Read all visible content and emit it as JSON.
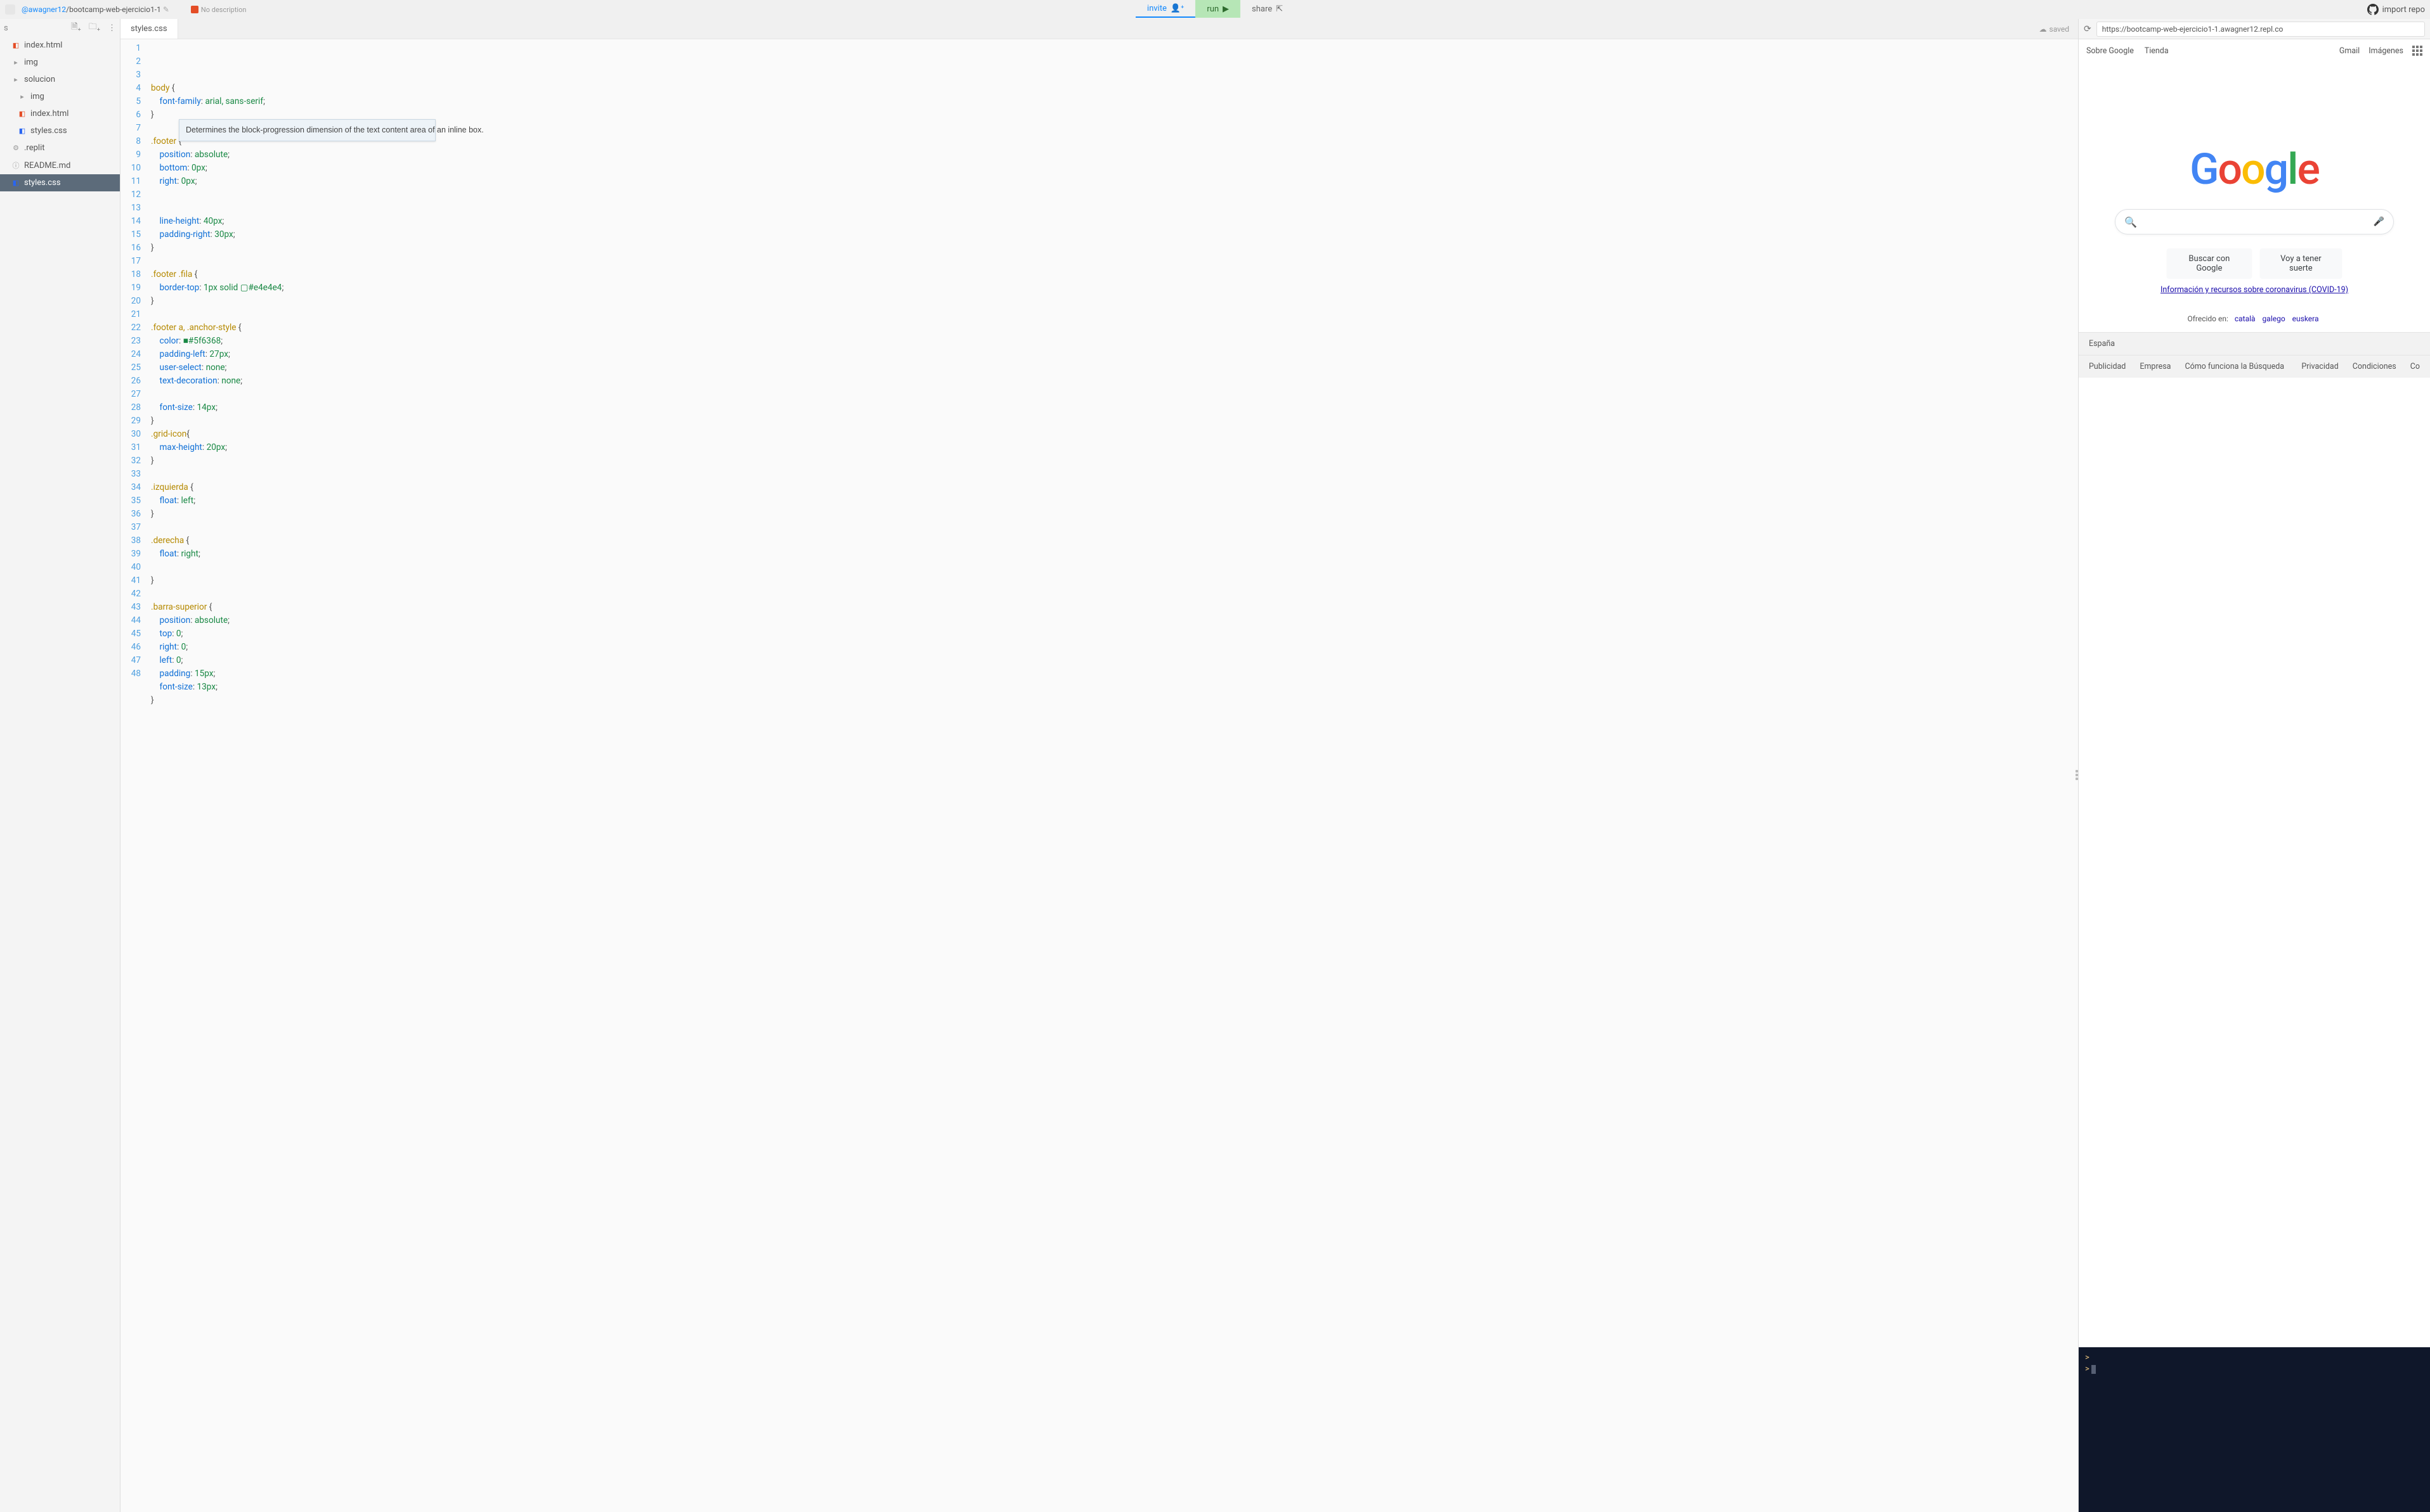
{
  "header": {
    "user": "@awagner12",
    "project": "bootcamp-web-ejercicio1-1",
    "no_description": "No description",
    "invite": "invite",
    "run": "run",
    "share": "share",
    "import_repo": "import repo"
  },
  "sidebar": {
    "head_label": "s",
    "items": [
      {
        "label": "index.html",
        "icon": "html"
      },
      {
        "label": "img",
        "icon": "folder"
      },
      {
        "label": "solucion",
        "icon": "folder"
      },
      {
        "label": "img",
        "icon": "folder",
        "child": true
      },
      {
        "label": "index.html",
        "icon": "html",
        "child": true
      },
      {
        "label": "styles.css",
        "icon": "css",
        "child": true
      },
      {
        "label": ".replit",
        "icon": "gear"
      },
      {
        "label": "README.md",
        "icon": "md"
      },
      {
        "label": "styles.css",
        "icon": "css",
        "active": true
      }
    ]
  },
  "editor": {
    "tab": "styles.css",
    "saved": "saved",
    "tooltip": "Determines the block-progression dimension of the text content area of an inline box.",
    "lines": [
      {
        "n": 1,
        "t": "body {",
        "cls": "sel"
      },
      {
        "n": 2,
        "t": "    font-family: arial, sans-serif;",
        "p": "font-family",
        "v": "arial, sans-serif"
      },
      {
        "n": 3,
        "t": "}",
        "cls": "punc"
      },
      {
        "n": 4,
        "t": ""
      },
      {
        "n": 5,
        "t": ".footer {",
        "cls": "sel"
      },
      {
        "n": 6,
        "t": "    position: absolute;",
        "p": "position",
        "v": "absolute"
      },
      {
        "n": 7,
        "t": "    bottom: 0px;",
        "p": "bottom",
        "v": "0px"
      },
      {
        "n": 8,
        "t": "    right: 0px;",
        "p": "right",
        "v": "0px"
      },
      {
        "n": 9,
        "t": ""
      },
      {
        "n": 10,
        "t": ""
      },
      {
        "n": 11,
        "t": "    line-height: 40px;",
        "p": "line-height",
        "v": "40px"
      },
      {
        "n": 12,
        "t": "    padding-right: 30px;",
        "p": "padding-right",
        "v": "30px"
      },
      {
        "n": 13,
        "t": "}",
        "cls": "punc"
      },
      {
        "n": 14,
        "t": ""
      },
      {
        "n": 15,
        "t": ".footer .fila {",
        "cls": "sel"
      },
      {
        "n": 16,
        "t": "    border-top: 1px solid ▢#e4e4e4;",
        "p": "border-top",
        "v": "1px solid ▢#e4e4e4"
      },
      {
        "n": 17,
        "t": "}",
        "cls": "punc"
      },
      {
        "n": 18,
        "t": ""
      },
      {
        "n": 19,
        "t": ".footer a, .anchor-style {",
        "cls": "sel"
      },
      {
        "n": 20,
        "t": "    color: ■#5f6368;",
        "p": "color",
        "v": "■#5f6368"
      },
      {
        "n": 21,
        "t": "    padding-left: 27px;",
        "p": "padding-left",
        "v": "27px"
      },
      {
        "n": 22,
        "t": "    user-select: none;",
        "p": "user-select",
        "v": "none"
      },
      {
        "n": 23,
        "t": "    text-decoration: none;",
        "p": "text-decoration",
        "v": "none"
      },
      {
        "n": 24,
        "t": ""
      },
      {
        "n": 25,
        "t": "    font-size: 14px;",
        "p": "font-size",
        "v": "14px"
      },
      {
        "n": 26,
        "t": "}",
        "cls": "punc"
      },
      {
        "n": 27,
        "t": ".grid-icon{",
        "cls": "sel"
      },
      {
        "n": 28,
        "t": "    max-height: 20px;",
        "p": "max-height",
        "v": "20px"
      },
      {
        "n": 29,
        "t": "}",
        "cls": "punc"
      },
      {
        "n": 30,
        "t": ""
      },
      {
        "n": 31,
        "t": ".izquierda {",
        "cls": "sel"
      },
      {
        "n": 32,
        "t": "    float: left;",
        "p": "float",
        "v": "left"
      },
      {
        "n": 33,
        "t": "}",
        "cls": "punc"
      },
      {
        "n": 34,
        "t": ""
      },
      {
        "n": 35,
        "t": ".derecha {",
        "cls": "sel"
      },
      {
        "n": 36,
        "t": "    float: right;",
        "p": "float",
        "v": "right"
      },
      {
        "n": 37,
        "t": ""
      },
      {
        "n": 38,
        "t": "}",
        "cls": "punc"
      },
      {
        "n": 39,
        "t": ""
      },
      {
        "n": 40,
        "t": ".barra-superior {",
        "cls": "sel"
      },
      {
        "n": 41,
        "t": "    position: absolute;",
        "p": "position",
        "v": "absolute"
      },
      {
        "n": 42,
        "t": "    top: 0;",
        "p": "top",
        "v": "0"
      },
      {
        "n": 43,
        "t": "    right: 0;",
        "p": "right",
        "v": "0"
      },
      {
        "n": 44,
        "t": "    left: 0;",
        "p": "left",
        "v": "0"
      },
      {
        "n": 45,
        "t": "    padding:15px;",
        "p": "padding",
        "v": "15px"
      },
      {
        "n": 46,
        "t": "    font-size:13px;",
        "p": "font-size",
        "v": "13px"
      },
      {
        "n": 47,
        "t": "}",
        "cls": "punc"
      },
      {
        "n": 48,
        "t": ""
      }
    ]
  },
  "preview": {
    "url": "https://bootcamp-web-ejercicio1-1.awagner12.repl.co",
    "top_left": [
      "Sobre Google",
      "Tienda"
    ],
    "top_right": [
      "Gmail",
      "Imágenes"
    ],
    "search_btn": "Buscar con Google",
    "lucky_btn": "Voy a tener suerte",
    "covid": "Información y recursos sobre coronavirus (COVID-19)",
    "offered_label": "Ofrecido en:",
    "offered_langs": [
      "català",
      "galego",
      "euskera"
    ],
    "footer_country": "España",
    "footer_left": [
      "Publicidad",
      "Empresa",
      "Cómo funciona la Búsqueda"
    ],
    "footer_right": [
      "Privacidad",
      "Condiciones",
      "Co"
    ]
  },
  "terminal": {
    "prompt": ">"
  }
}
